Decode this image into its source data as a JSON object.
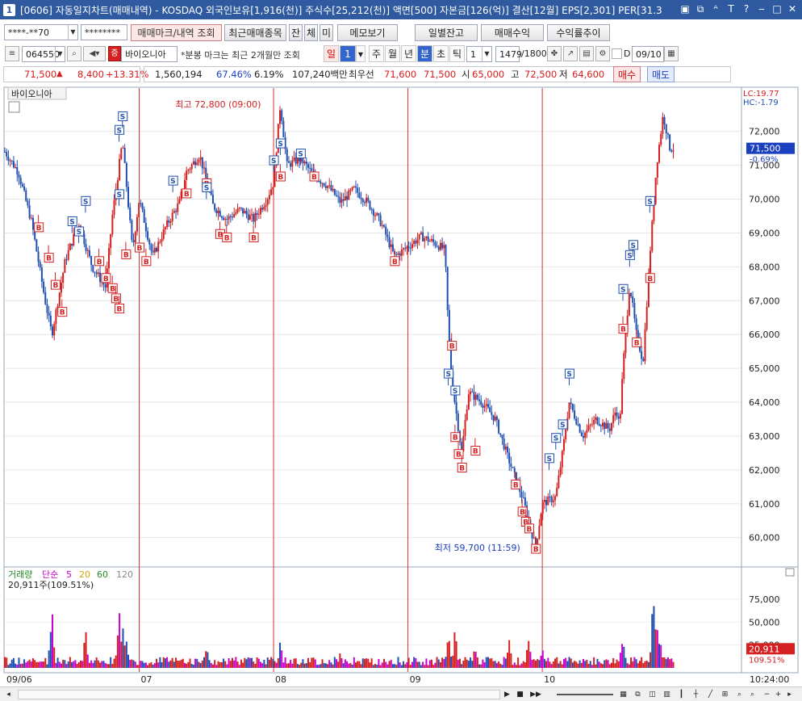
{
  "window": {
    "number": "1",
    "title": "[0606] 자동일지차트(매매내역) - KOSDAQ 외국인보유[1,916(천)] 주식수[25,212(천)] 액면[500] 자본금[126(억)] 결산[12월] EPS[2,301] PER[31.3"
  },
  "toolbar1": {
    "account": "****-**70",
    "password": "********",
    "btn_trade_mark": "매매마크/내역 조회",
    "btn_recent_items": "최근매매종목",
    "btn_jan": "잔",
    "btn_che": "체",
    "btn_mi": "미",
    "btn_memo": "메모보기",
    "btn_daily_balance": "일별잔고",
    "btn_trade_profit": "매매수익",
    "btn_return_trend": "수익률추이"
  },
  "toolbar2": {
    "code": "064550",
    "stock_name": "바이오니아",
    "notice": "*분봉 마크는 최근 2개월만 조회",
    "period_day": "일",
    "period_value": "1",
    "periods": [
      "주",
      "월",
      "년",
      "분",
      "초",
      "틱"
    ],
    "tick_value": "1",
    "count": "1479",
    "count_max": "/1800",
    "d_label": "D",
    "date": "09/10"
  },
  "quote": {
    "price": "71,500",
    "change": "8,400",
    "change_pct": "+13.31%",
    "volume": "1,560,194",
    "ratio1": "67.46%",
    "ratio2": "6.19%",
    "amount": "107,240백만",
    "best_ask_label": "최우선",
    "best_ask": "71,600",
    "best_bid": "71,500",
    "open_label": "시",
    "open": "65,000",
    "high_label": "고",
    "high": "72,500",
    "low_label": "저",
    "low": "64,600",
    "buy_btn": "매수",
    "sell_btn": "매도"
  },
  "chart_data": {
    "type": "candlestick",
    "title": "바이오니아",
    "lc_label": "LC:19.77",
    "hc_label": "HC:-1.79",
    "y_ticks": [
      60000,
      61000,
      62000,
      63000,
      64000,
      65000,
      66000,
      67000,
      68000,
      69000,
      70000,
      71000,
      72000
    ],
    "y_tick_labels": [
      "60,000",
      "61,000",
      "62,000",
      "63,000",
      "64,000",
      "65,000",
      "66,000",
      "67,000",
      "68,000",
      "69,000",
      "70,000",
      "71,000",
      "72,000"
    ],
    "ylim": [
      59300,
      72900
    ],
    "current_price_label": "71,500",
    "current_change_label": "-0.69%",
    "high_annotation": "최고 72,800 (09:00)",
    "low_annotation": "최저 59,700 (11:59)",
    "x_labels": [
      "09/06",
      "07",
      "08",
      "09",
      "10"
    ],
    "session_breaks": [
      0.2,
      0.4,
      0.6,
      0.8
    ],
    "price_path": [
      [
        0.0,
        71400
      ],
      [
        0.02,
        70800
      ],
      [
        0.04,
        69300
      ],
      [
        0.06,
        67000
      ],
      [
        0.07,
        66000
      ],
      [
        0.09,
        68200
      ],
      [
        0.11,
        69300
      ],
      [
        0.13,
        68000
      ],
      [
        0.15,
        67400
      ],
      [
        0.16,
        69500
      ],
      [
        0.175,
        71700
      ],
      [
        0.19,
        68500
      ],
      [
        0.2,
        70000
      ],
      [
        0.22,
        68300
      ],
      [
        0.24,
        69200
      ],
      [
        0.26,
        69900
      ],
      [
        0.27,
        70800
      ],
      [
        0.29,
        71300
      ],
      [
        0.31,
        69800
      ],
      [
        0.33,
        69400
      ],
      [
        0.35,
        69700
      ],
      [
        0.37,
        69400
      ],
      [
        0.39,
        70000
      ],
      [
        0.4,
        70500
      ],
      [
        0.41,
        72800
      ],
      [
        0.42,
        71000
      ],
      [
        0.44,
        71200
      ],
      [
        0.46,
        70700
      ],
      [
        0.48,
        70400
      ],
      [
        0.5,
        69900
      ],
      [
        0.52,
        70300
      ],
      [
        0.54,
        69900
      ],
      [
        0.56,
        69300
      ],
      [
        0.58,
        68300
      ],
      [
        0.6,
        68600
      ],
      [
        0.62,
        68900
      ],
      [
        0.64,
        68700
      ],
      [
        0.655,
        68500
      ],
      [
        0.66,
        66200
      ],
      [
        0.665,
        64700
      ],
      [
        0.68,
        62500
      ],
      [
        0.69,
        64300
      ],
      [
        0.71,
        64000
      ],
      [
        0.73,
        63500
      ],
      [
        0.75,
        62300
      ],
      [
        0.77,
        61200
      ],
      [
        0.78,
        60500
      ],
      [
        0.79,
        59700
      ],
      [
        0.8,
        61000
      ],
      [
        0.82,
        61200
      ],
      [
        0.83,
        62500
      ],
      [
        0.84,
        64000
      ],
      [
        0.86,
        63000
      ],
      [
        0.88,
        63500
      ],
      [
        0.9,
        63200
      ],
      [
        0.91,
        63800
      ],
      [
        0.915,
        63300
      ],
      [
        0.92,
        65000
      ],
      [
        0.93,
        67500
      ],
      [
        0.94,
        66000
      ],
      [
        0.95,
        65200
      ],
      [
        0.96,
        68300
      ],
      [
        0.97,
        71000
      ],
      [
        0.98,
        72500
      ],
      [
        0.99,
        71500
      ]
    ],
    "buy_marks": [
      [
        0.05,
        69300
      ],
      [
        0.065,
        68400
      ],
      [
        0.075,
        67600
      ],
      [
        0.085,
        66800
      ],
      [
        0.14,
        68300
      ],
      [
        0.15,
        67800
      ],
      [
        0.16,
        67500
      ],
      [
        0.165,
        67200
      ],
      [
        0.17,
        66900
      ],
      [
        0.18,
        68500
      ],
      [
        0.2,
        68700
      ],
      [
        0.21,
        68300
      ],
      [
        0.27,
        70300
      ],
      [
        0.3,
        70600
      ],
      [
        0.32,
        69100
      ],
      [
        0.33,
        69000
      ],
      [
        0.37,
        69000
      ],
      [
        0.41,
        70800
      ],
      [
        0.46,
        70800
      ],
      [
        0.58,
        68300
      ],
      [
        0.665,
        65800
      ],
      [
        0.67,
        63100
      ],
      [
        0.675,
        62600
      ],
      [
        0.68,
        62200
      ],
      [
        0.7,
        62700
      ],
      [
        0.76,
        61700
      ],
      [
        0.77,
        60900
      ],
      [
        0.775,
        60600
      ],
      [
        0.78,
        60400
      ],
      [
        0.79,
        59800
      ],
      [
        0.92,
        66300
      ],
      [
        0.94,
        65900
      ],
      [
        0.96,
        67800
      ]
    ],
    "sell_marks": [
      [
        0.1,
        69000
      ],
      [
        0.11,
        68700
      ],
      [
        0.12,
        69600
      ],
      [
        0.17,
        71700
      ],
      [
        0.175,
        72100
      ],
      [
        0.17,
        69800
      ],
      [
        0.25,
        70200
      ],
      [
        0.3,
        70000
      ],
      [
        0.4,
        70800
      ],
      [
        0.41,
        71300
      ],
      [
        0.44,
        71000
      ],
      [
        0.66,
        64500
      ],
      [
        0.67,
        64000
      ],
      [
        0.81,
        62000
      ],
      [
        0.82,
        62600
      ],
      [
        0.83,
        63000
      ],
      [
        0.84,
        64500
      ],
      [
        0.92,
        67000
      ],
      [
        0.93,
        68000
      ],
      [
        0.935,
        68300
      ],
      [
        0.96,
        69600
      ]
    ],
    "volume_panel": {
      "title": "거래량",
      "ma_labels": [
        "단순",
        "5",
        "20",
        "60",
        "120"
      ],
      "ma_colors": [
        "#cc00cc",
        "#cc00cc",
        "#d4a000",
        "#228822",
        "#666666"
      ],
      "value_label": "20,911주(109.51%)",
      "y_ticks": [
        25000,
        50000,
        75000
      ],
      "y_tick_labels": [
        "25,000",
        "50,000",
        "75,000"
      ],
      "ylim": [
        0,
        90000
      ],
      "current_volume_label": "20,911",
      "current_volume_pct": "109.51%",
      "time_label": "10:24:00",
      "spikes": [
        [
          0.07,
          72000
        ],
        [
          0.12,
          45000
        ],
        [
          0.17,
          78000
        ],
        [
          0.175,
          62000
        ],
        [
          0.18,
          40000
        ],
        [
          0.3,
          30000
        ],
        [
          0.41,
          32000
        ],
        [
          0.5,
          20000
        ],
        [
          0.66,
          52000
        ],
        [
          0.67,
          45000
        ],
        [
          0.7,
          30000
        ],
        [
          0.75,
          38000
        ],
        [
          0.78,
          46000
        ],
        [
          0.8,
          24000
        ],
        [
          0.92,
          45000
        ],
        [
          0.965,
          85000
        ],
        [
          0.97,
          60000
        ],
        [
          0.975,
          50000
        ]
      ]
    },
    "colors": {
      "up": "#d42020",
      "down": "#1f4fb0",
      "session_line": "#d43030",
      "price_box": "#1a3fbf",
      "volume_box": "#d42020"
    }
  },
  "scrollbar": {
    "btn_play": "▶",
    "btn_pause": "■",
    "btn_next": "▶▶"
  }
}
